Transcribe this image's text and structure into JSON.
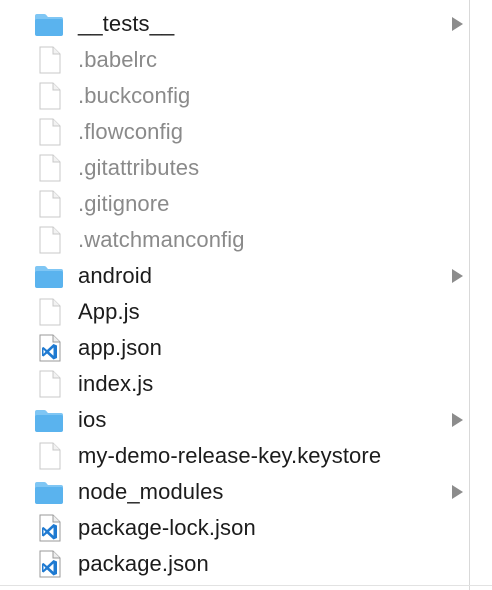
{
  "files": [
    {
      "name": "__tests__",
      "kind": "folder",
      "hidden": false,
      "expandable": true
    },
    {
      "name": ".babelrc",
      "kind": "document",
      "hidden": true,
      "expandable": false
    },
    {
      "name": ".buckconfig",
      "kind": "document",
      "hidden": true,
      "expandable": false
    },
    {
      "name": ".flowconfig",
      "kind": "document",
      "hidden": true,
      "expandable": false
    },
    {
      "name": ".gitattributes",
      "kind": "document",
      "hidden": true,
      "expandable": false
    },
    {
      "name": ".gitignore",
      "kind": "document",
      "hidden": true,
      "expandable": false
    },
    {
      "name": ".watchmanconfig",
      "kind": "document",
      "hidden": true,
      "expandable": false
    },
    {
      "name": "android",
      "kind": "folder",
      "hidden": false,
      "expandable": true
    },
    {
      "name": "App.js",
      "kind": "document",
      "hidden": false,
      "expandable": false
    },
    {
      "name": "app.json",
      "kind": "vscode-json",
      "hidden": false,
      "expandable": false
    },
    {
      "name": "index.js",
      "kind": "document",
      "hidden": false,
      "expandable": false
    },
    {
      "name": "ios",
      "kind": "folder",
      "hidden": false,
      "expandable": true
    },
    {
      "name": "my-demo-release-key.keystore",
      "kind": "document",
      "hidden": false,
      "expandable": false
    },
    {
      "name": "node_modules",
      "kind": "folder",
      "hidden": false,
      "expandable": true
    },
    {
      "name": "package-lock.json",
      "kind": "vscode-json",
      "hidden": false,
      "expandable": false
    },
    {
      "name": "package.json",
      "kind": "vscode-json",
      "hidden": false,
      "expandable": false
    }
  ],
  "icons": {
    "folder": "folder-icon",
    "document": "document-icon",
    "vscode-json": "vscode-document-icon"
  },
  "colors": {
    "folder_body": "#5ab3ee",
    "folder_tab": "#7fc6f4",
    "document_stroke": "#c8c8c8",
    "vscode_blue": "#1f7ad1",
    "hidden_text": "#8a8a8a",
    "text": "#1c1c1c",
    "disclosure": "#8c8c8c"
  }
}
